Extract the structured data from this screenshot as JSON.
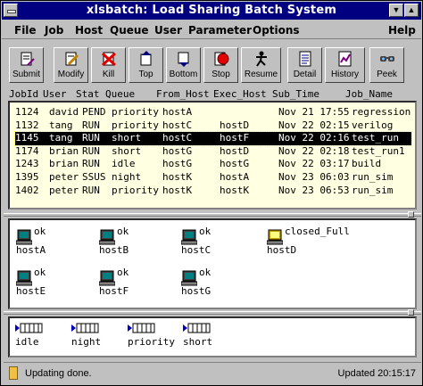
{
  "window": {
    "title": "xlsbatch: Load Sharing Batch System",
    "minimize_glyph": "▼",
    "maximize_glyph": "▲"
  },
  "menu": [
    {
      "label": "File"
    },
    {
      "label": "Job"
    },
    {
      "label": "Host"
    },
    {
      "label": "Queue"
    },
    {
      "label": "User"
    },
    {
      "label": "Parameter"
    },
    {
      "label": "Options"
    },
    {
      "label": "Help"
    }
  ],
  "toolbar": [
    {
      "label": "Submit",
      "icon": "submit-icon"
    },
    {
      "label": "Modify",
      "icon": "modify-icon"
    },
    {
      "label": "Kill",
      "icon": "kill-icon"
    },
    {
      "label": "Top",
      "icon": "top-icon"
    },
    {
      "label": "Bottom",
      "icon": "bottom-icon"
    },
    {
      "label": "Stop",
      "icon": "stop-icon"
    },
    {
      "label": "Resume",
      "icon": "resume-icon"
    },
    {
      "label": "Detail",
      "icon": "detail-icon"
    },
    {
      "label": "History",
      "icon": "history-icon"
    },
    {
      "label": "Peek",
      "icon": "peek-icon"
    }
  ],
  "job_columns": [
    "JobId",
    "User",
    "Stat",
    "Queue",
    "From_Host",
    "Exec_Host",
    "Sub_Time",
    "Job_Name"
  ],
  "jobs": [
    {
      "id": "1124",
      "user": "david",
      "stat": "PEND",
      "queue": "priority",
      "from": "hostA",
      "exec": "",
      "time": "Nov 21 17:55",
      "name": "regression",
      "selected": false
    },
    {
      "id": "1132",
      "user": "tang",
      "stat": "RUN",
      "queue": "priority",
      "from": "hostC",
      "exec": "hostD",
      "time": "Nov 22 02:15",
      "name": "verilog",
      "selected": false
    },
    {
      "id": "1145",
      "user": "tang",
      "stat": "RUN",
      "queue": "short",
      "from": "hostC",
      "exec": "hostF",
      "time": "Nov 22 02:16",
      "name": "test_run",
      "selected": true
    },
    {
      "id": "1174",
      "user": "brian",
      "stat": "RUN",
      "queue": "short",
      "from": "hostG",
      "exec": "hostD",
      "time": "Nov 22 02:18",
      "name": "test_run1",
      "selected": false
    },
    {
      "id": "1243",
      "user": "brian",
      "stat": "RUN",
      "queue": "idle",
      "from": "hostG",
      "exec": "hostG",
      "time": "Nov 22 03:17",
      "name": "build",
      "selected": false
    },
    {
      "id": "1395",
      "user": "peter",
      "stat": "SSUS",
      "queue": "night",
      "from": "hostK",
      "exec": "hostA",
      "time": "Nov 23 06:03",
      "name": "run_sim",
      "selected": false
    },
    {
      "id": "1402",
      "user": "peter",
      "stat": "RUN",
      "queue": "priority",
      "from": "hostK",
      "exec": "hostK",
      "time": "Nov 23 06:53",
      "name": "run_sim",
      "selected": false
    }
  ],
  "hosts": [
    {
      "name": "hostA",
      "status": "ok",
      "icon": "computer-icon"
    },
    {
      "name": "hostB",
      "status": "ok",
      "icon": "computer-icon"
    },
    {
      "name": "hostC",
      "status": "ok",
      "icon": "computer-icon"
    },
    {
      "name": "hostD",
      "status": "closed_Full",
      "icon": "computer-closed-icon"
    },
    {
      "name": "hostE",
      "status": "ok",
      "icon": "computer-icon"
    },
    {
      "name": "hostF",
      "status": "ok",
      "icon": "computer-icon"
    },
    {
      "name": "hostG",
      "status": "ok",
      "icon": "computer-icon"
    }
  ],
  "queues": [
    {
      "name": "idle",
      "icon": "queue-icon"
    },
    {
      "name": "night",
      "icon": "queue-icon"
    },
    {
      "name": "priority",
      "icon": "queue-icon"
    },
    {
      "name": "short",
      "icon": "queue-icon"
    }
  ],
  "status": {
    "message": "Updating done.",
    "updated": "Updated 20:15:17"
  },
  "colors": {
    "titlebar": "#000080",
    "joblist_bg": "#ffffe1",
    "selection": "#000000",
    "stop_red": "#e00000",
    "queue_blue": "#0000c0"
  }
}
